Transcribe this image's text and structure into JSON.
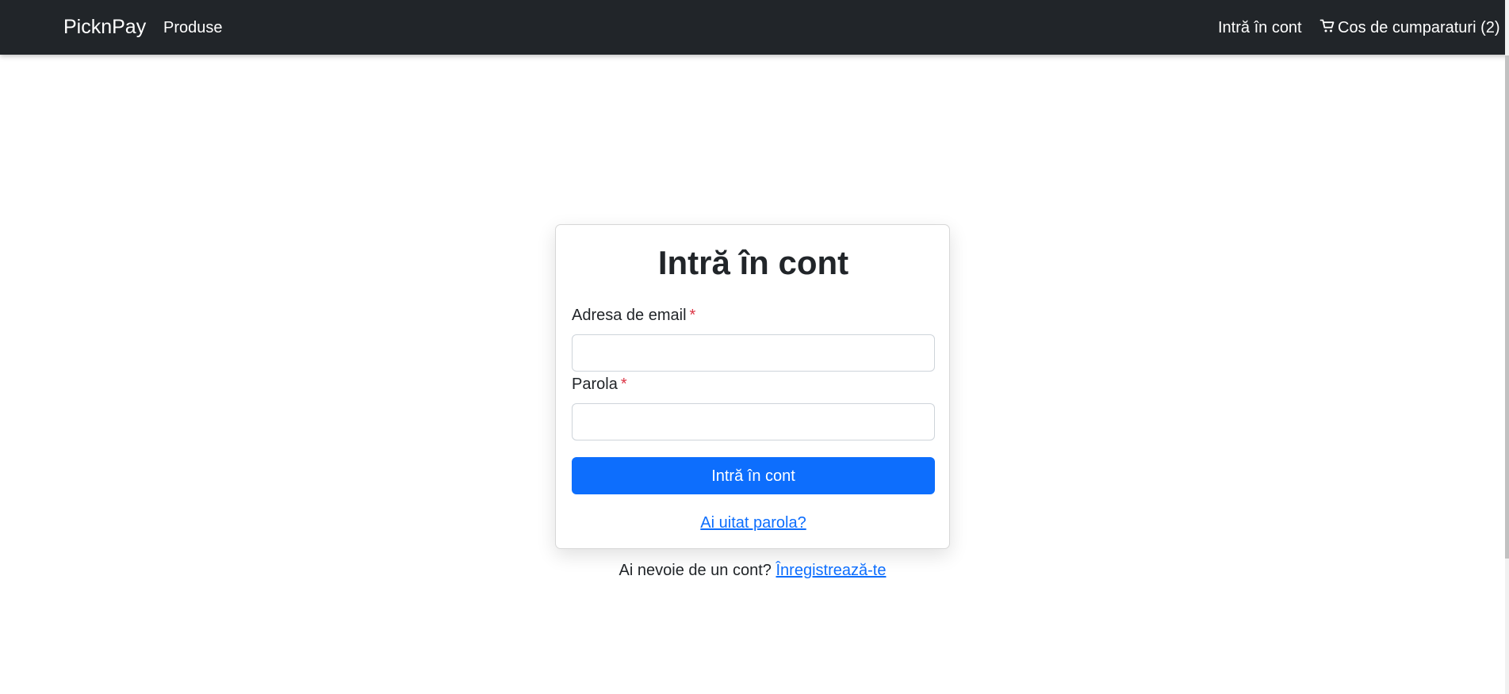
{
  "navbar": {
    "brand": "PicknPay",
    "products_link": "Produse",
    "login_link": "Intră în cont",
    "cart_icon": "shopping-cart-icon",
    "cart_label": "Cos de cumparaturi (2)"
  },
  "login_card": {
    "title": "Intră în cont",
    "email_label": "Adresa de email",
    "email_required_mark": "*",
    "email_value": "",
    "password_label": "Parola",
    "password_required_mark": "*",
    "password_value": "",
    "submit_label": "Intră în cont",
    "forgot_password_link": "Ai uitat parola?"
  },
  "signup": {
    "prompt": "Ai nevoie de un cont?",
    "link": "Înregistrează-te"
  },
  "colors": {
    "navbar_background": "#212529",
    "primary": "#0d6efd",
    "required": "#dc3545",
    "text": "#212529"
  }
}
